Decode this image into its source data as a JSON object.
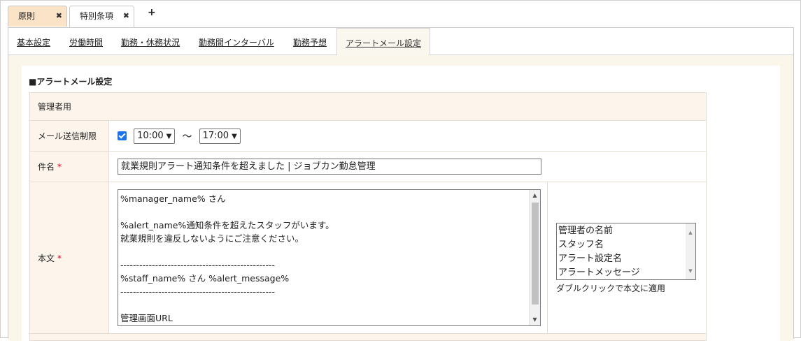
{
  "doc_tabs": [
    {
      "label": "原則",
      "close": "✖"
    },
    {
      "label": "特別条項",
      "close": "✖"
    }
  ],
  "add_tab_label": "+",
  "sub_tabs": [
    "基本設定",
    "労働時間",
    "勤務・休務状況",
    "勤務間インターバル",
    "勤務予想",
    "アラートメール設定"
  ],
  "section_title": "■アラートメール設定",
  "form": {
    "group_label": "管理者用",
    "send_limit": {
      "label": "メール送信制限",
      "checked": true,
      "from": "10:00",
      "tilde": "〜",
      "to": "17:00"
    },
    "subject": {
      "label": "件名",
      "required_mark": "*",
      "value": "就業規則アラート通知条件を超えました | ジョブカン勤怠管理"
    },
    "body": {
      "label": "本文",
      "required_mark": "*",
      "lines": [
        "%manager_name% さん",
        "",
        "%alert_name%通知条件を超えたスタッフがいます。",
        "就業規則を違反しないようにご注意ください。",
        "",
        "-------------------------------------------------",
        "%staff_name% さん %alert_message%",
        "-------------------------------------------------",
        "",
        "管理画面URL"
      ]
    },
    "variables": {
      "options": [
        "管理者の名前",
        "スタッフ名",
        "アラート設定名",
        "アラートメッセージ"
      ],
      "hint": "ダブルクリックで本文に適用"
    }
  },
  "colors": {
    "orig_tab_bg": "#fbe3c8",
    "label_bg": "#fdf5ec",
    "page_bg": "#faf6e9",
    "required": "#d9001b",
    "checkbox": "#1a73e8"
  }
}
